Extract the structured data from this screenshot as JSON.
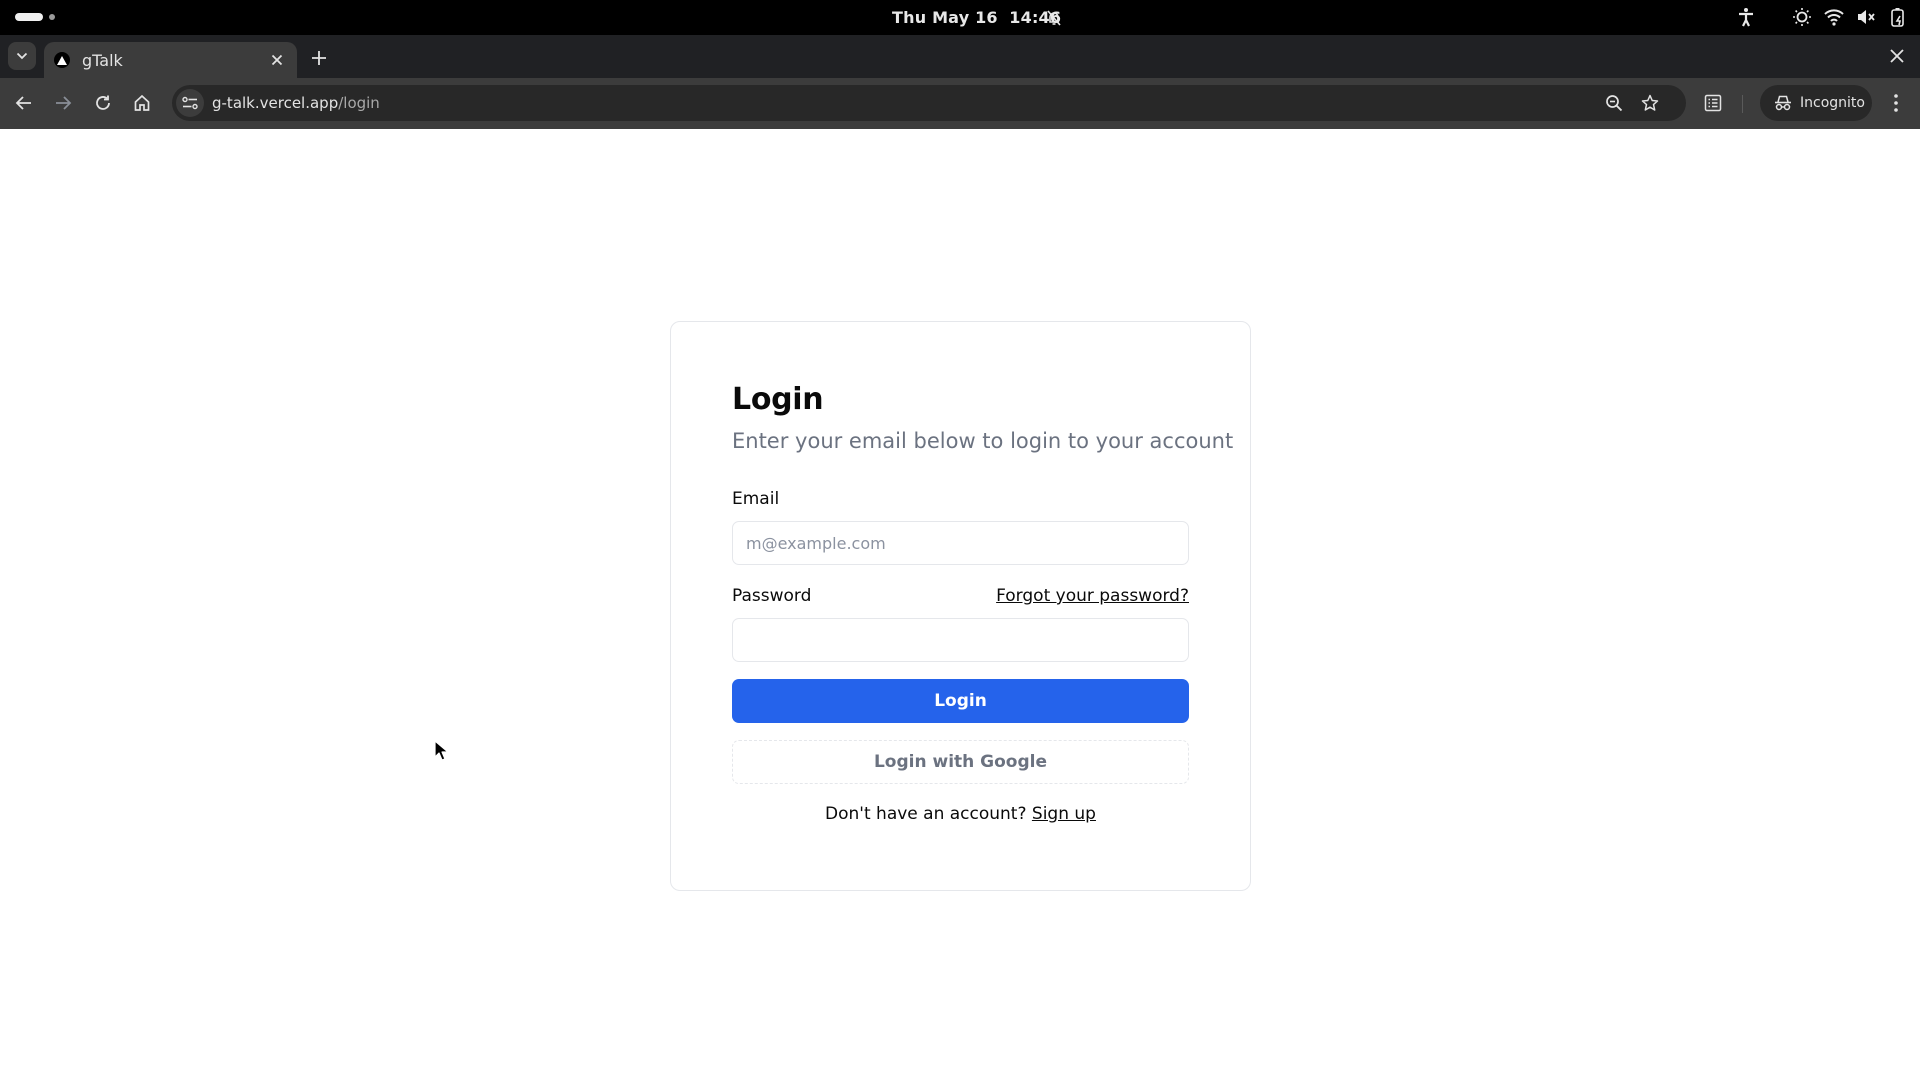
{
  "os": {
    "clock": "Thu May 16  14:46",
    "icons": [
      "activities-indicator",
      "notifications-muted-icon",
      "accessibility-icon",
      "night-light-icon",
      "wifi-icon",
      "volume-muted-icon",
      "battery-charging-icon"
    ]
  },
  "browser": {
    "tabs": [
      {
        "title": "gTalk",
        "active": true,
        "favicon": "vercel-triangle-icon"
      }
    ],
    "url": {
      "host": "g-talk.vercel.app",
      "path": "/login"
    },
    "incognito_label": "Incognito"
  },
  "login": {
    "title": "Login",
    "subtitle": "Enter your email below to login to your account",
    "email": {
      "label": "Email",
      "placeholder": "m@example.com",
      "value": ""
    },
    "password": {
      "label": "Password",
      "value": "",
      "forgot_link": "Forgot your password?"
    },
    "submit_label": "Login",
    "google_label": "Login with Google",
    "signup_prompt": "Don't have an account?",
    "signup_link": "Sign up"
  },
  "colors": {
    "primary": "#2563eb",
    "muted_text": "#6b7280",
    "border": "#e5e7eb"
  }
}
